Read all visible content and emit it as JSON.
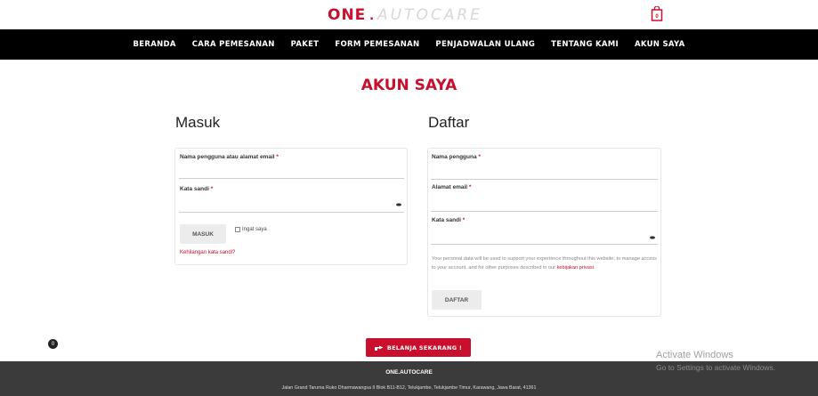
{
  "header": {
    "logo_part1": "ONE",
    "logo_dot": ".",
    "logo_part2": "AUTOCARE"
  },
  "nav": {
    "items": [
      "BERANDA",
      "CARA PEMESANAN",
      "PAKET",
      "FORM PEMESANAN",
      "PENJADWALAN ULANG",
      "TENTANG KAMI",
      "AKUN SAYA"
    ]
  },
  "page_title": "AKUN SAYA",
  "login": {
    "title": "Masuk",
    "username_label": "Nama pengguna atau alamat email",
    "password_label": "Kata sandi",
    "required_mark": "*",
    "submit_label": "MASUK",
    "remember_label": "Ingat saya",
    "lost_password": "Kehilangan kata sandi?"
  },
  "register": {
    "title": "Daftar",
    "username_label": "Nama pengguna",
    "email_label": "Alamat email",
    "password_label": "Kata sandi",
    "required_mark": "*",
    "privacy_text": "Your personal data will be used to support your experience throughout this website, to manage access to your account, and for other purposes described in our",
    "privacy_link": "kebijakan privasi",
    "privacy_end": ".",
    "submit_label": "DAFTAR"
  },
  "cta": {
    "label": "BELANJA SEKARANG !",
    "icon": "pointing-hand-icon"
  },
  "floating_cart": {
    "count": "0",
    "icon": "cart-icon"
  },
  "footer": {
    "name": "ONE.AUTOCARE",
    "address": "Jalan Grand Taruma Ruko Dharmawangsa II Blok B11-B12, Telukjambe, Telukjambe Timur, Karawang, Jawa Barat, 41361"
  },
  "watermark": {
    "line1": "Activate Windows",
    "line2": "Go to Settings to activate Windows."
  },
  "colors": {
    "accent": "#c8102e",
    "nav_bg": "#000000",
    "footer_bg": "#3b3b3b",
    "button_grey": "#ececec"
  }
}
